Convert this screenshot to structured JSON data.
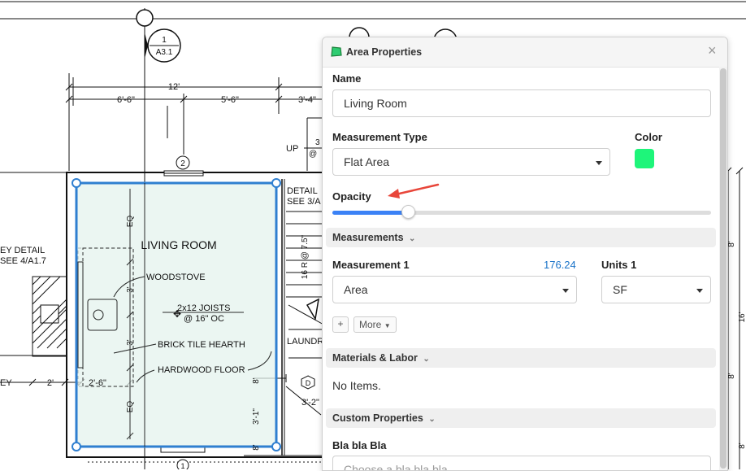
{
  "drawing": {
    "bubble_top_num": "1",
    "bubble_top_ref": "A3.1",
    "dim_total": "12'",
    "dim_left": "6'-6\"",
    "dim_right": "5'-6\"",
    "dim_partial": "3'-4\"",
    "grid_marker_2": "2",
    "grid_marker_1": "1",
    "up_label": "UP",
    "stair_num": "3",
    "stair_at": "@",
    "room_name": "LIVING ROOM",
    "woodstove": "WOODSTOVE",
    "joists_line1": "2x12 JOISTS",
    "joists_line2": "@ 16\" OC",
    "brick_hearth": "BRICK TILE HEARTH",
    "hardwood": "HARDWOOD FLOOR",
    "eq_top": "EQ",
    "eq_bottom": "EQ",
    "dim_3a": "3'",
    "dim_3b": "3'",
    "key_detail_line1": "EY DETAIL",
    "key_detail_line2": "SEE 4/A1.7",
    "key_left": "EY",
    "dim_2": "2'",
    "dim_2_6": "2'-6\"",
    "detail_line1": "DETAIL",
    "detail_line2": "SEE 3/A",
    "stair_rise": "16 R @ 7.5\"",
    "laundry": "LAUNDR",
    "dim_8a": "8'",
    "dim_3_1": "3'-1\"",
    "dim_8b": "8'",
    "dim_3_2": "3'-2\"",
    "marker_d": "D",
    "right_8a": "8'",
    "right_16": "16'",
    "right_8b": "8'",
    "right_8c": "8'"
  },
  "panel": {
    "title": "Area Properties",
    "close_symbol": "×",
    "name_label": "Name",
    "name_value": "Living Room",
    "measurement_type_label": "Measurement Type",
    "measurement_type_value": "Flat Area",
    "color_label": "Color",
    "color_value": "#1ef57a",
    "opacity_label": "Opacity",
    "opacity_value": 0.2,
    "measurements_section": "Measurements",
    "measurement1_label": "Measurement 1",
    "measurement1_value": "176.24",
    "measurement1_select": "Area",
    "units1_label": "Units 1",
    "units1_value": "SF",
    "add_symbol": "+",
    "more_label": "More",
    "materials_section": "Materials & Labor",
    "no_items": "No Items.",
    "custom_section": "Custom Properties",
    "bla_label": "Bla bla Bla",
    "bla_placeholder": "Choose a bla bla bla"
  },
  "colors": {
    "accent": "#3b82f6",
    "selection": "#2f7fd0",
    "area_fill": "#e4f3ee",
    "link_value": "#1a73c8",
    "arrow": "#e8463a"
  }
}
